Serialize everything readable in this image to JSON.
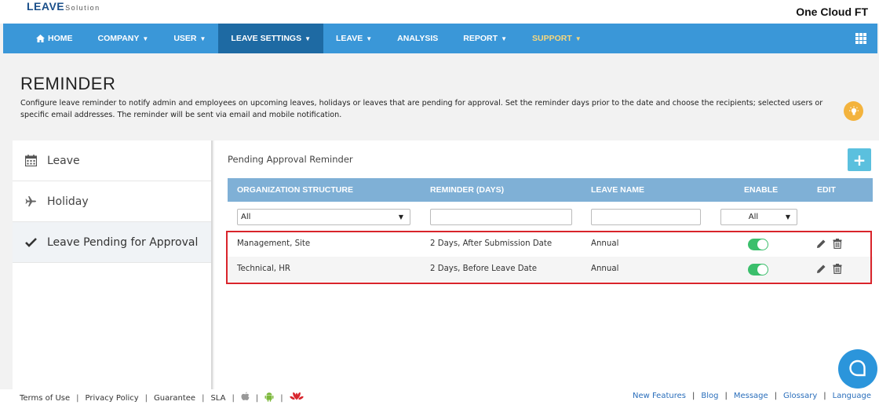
{
  "header": {
    "logo_main": "LEAVE",
    "logo_sub": "Solution",
    "company_name": "One Cloud FT"
  },
  "nav": {
    "items": [
      {
        "label": "HOME"
      },
      {
        "label": "COMPANY"
      },
      {
        "label": "USER"
      },
      {
        "label": "LEAVE SETTINGS"
      },
      {
        "label": "LEAVE"
      },
      {
        "label": "ANALYSIS"
      },
      {
        "label": "REPORT"
      },
      {
        "label": "SUPPORT"
      }
    ],
    "active": "LEAVE SETTINGS"
  },
  "page": {
    "title": "REMINDER",
    "description": "Configure leave reminder to notify admin and employees on upcoming leaves, holidays or leaves that are pending for approval. Set the reminder days prior to the date and choose the recipients; selected users or specific email addresses. The reminder will be sent via email and mobile notification."
  },
  "sidebar": {
    "items": [
      {
        "label": "Leave",
        "icon": "calendar-icon"
      },
      {
        "label": "Holiday",
        "icon": "plane-icon"
      },
      {
        "label": "Leave Pending for Approval",
        "icon": "check-icon"
      }
    ],
    "active": "Leave Pending for Approval"
  },
  "main": {
    "section_title": "Pending Approval Reminder",
    "add_label": "+",
    "columns": [
      "ORGANIZATION STRUCTURE",
      "REMINDER (DAYS)",
      "LEAVE NAME",
      "ENABLE",
      "EDIT"
    ],
    "filters": {
      "org": "All",
      "reminder": "",
      "leave_name": "",
      "enable": "All"
    },
    "rows": [
      {
        "org": "Management, Site",
        "reminder": "2 Days, After Submission Date",
        "leave_name": "Annual",
        "enabled": true
      },
      {
        "org": "Technical, HR",
        "reminder": "2 Days, Before Leave Date",
        "leave_name": "Annual",
        "enabled": true
      }
    ]
  },
  "footer": {
    "left": [
      "Terms of Use",
      "Privacy Policy",
      "Guarantee",
      "SLA"
    ],
    "right": [
      "New Features",
      "Blog",
      "Message",
      "Glossary",
      "Language"
    ]
  },
  "colors": {
    "nav": "#3a97d8",
    "nav_active": "#1e6aa3",
    "table_header": "#7fb0d6",
    "toggle_on": "#3bbf6c",
    "highlight": "#d9242b"
  }
}
